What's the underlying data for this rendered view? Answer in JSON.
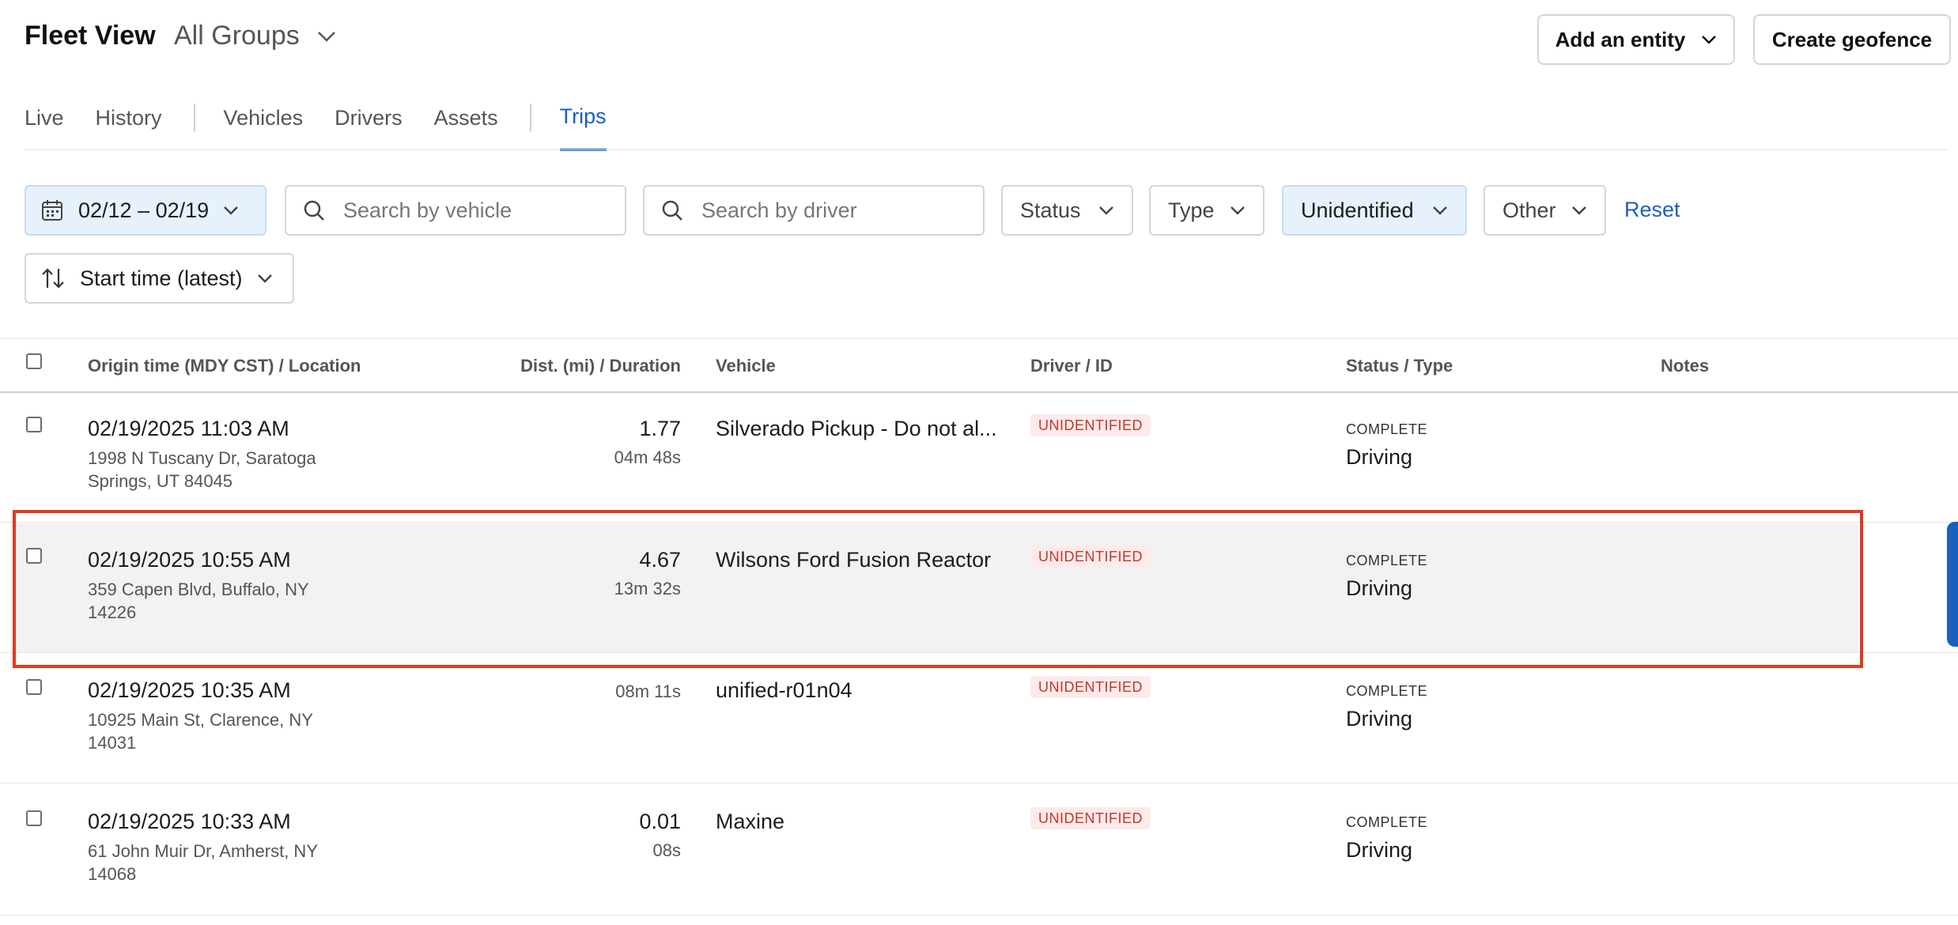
{
  "header": {
    "title": "Fleet View",
    "group_label": "All Groups",
    "add_entity_label": "Add an entity",
    "create_geofence_label": "Create geofence"
  },
  "tabs": [
    {
      "label": "Live"
    },
    {
      "label": "History"
    },
    {
      "label": "Vehicles"
    },
    {
      "label": "Drivers"
    },
    {
      "label": "Assets"
    },
    {
      "label": "Trips",
      "active": true
    }
  ],
  "filters": {
    "date_range": "02/12 – 02/19",
    "vehicle_search_placeholder": "Search by vehicle",
    "driver_search_placeholder": "Search by driver",
    "status_label": "Status",
    "type_label": "Type",
    "unidentified_label": "Unidentified",
    "other_label": "Other",
    "reset_label": "Reset",
    "sort_label": "Start time (latest)"
  },
  "table": {
    "columns": {
      "origin": "Origin time (MDY CST) / Location",
      "distance": "Dist. (mi) / Duration",
      "vehicle": "Vehicle",
      "driver": "Driver / ID",
      "status": "Status / Type",
      "notes": "Notes"
    },
    "rows": [
      {
        "time": "02/19/2025 11:03 AM",
        "address_line1": "1998 N Tuscany Dr, Saratoga",
        "address_line2": "Springs, UT 84045",
        "distance": "1.77",
        "duration": "04m 48s",
        "vehicle": "Silverado Pickup - Do not al...",
        "driver": "UNIDENTIFIED",
        "status": "COMPLETE",
        "type": "Driving"
      },
      {
        "time": "02/19/2025 10:55 AM",
        "address_line1": "359 Capen Blvd, Buffalo, NY",
        "address_line2": "14226",
        "distance": "4.67",
        "duration": "13m 32s",
        "vehicle": "Wilsons Ford Fusion Reactor",
        "driver": "UNIDENTIFIED",
        "status": "COMPLETE",
        "type": "Driving"
      },
      {
        "time": "02/19/2025 10:35 AM",
        "address_line1": "10925 Main St, Clarence, NY",
        "address_line2": "14031",
        "distance": "",
        "duration": "08m 11s",
        "vehicle": "unified-r01n04",
        "driver": "UNIDENTIFIED",
        "status": "COMPLETE",
        "type": "Driving"
      },
      {
        "time": "02/19/2025 10:33 AM",
        "address_line1": "61 John Muir Dr, Amherst, NY",
        "address_line2": "14068",
        "distance": "0.01",
        "duration": "08s",
        "vehicle": "Maxine",
        "driver": "UNIDENTIFIED",
        "status": "COMPLETE",
        "type": "Driving"
      }
    ]
  },
  "colors": {
    "accent": "#1b5fbf",
    "highlight_border": "#e2391f",
    "badge_bg": "#fdeaea",
    "badge_text": "#c0392b"
  }
}
